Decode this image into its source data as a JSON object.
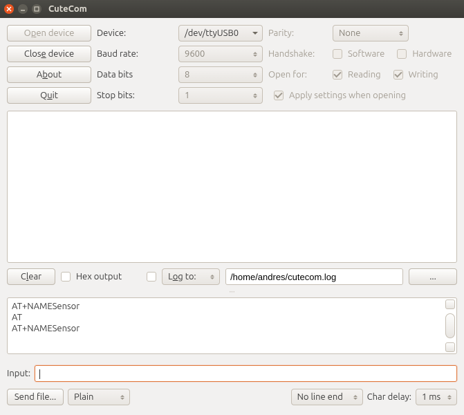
{
  "window": {
    "title": "CuteCom"
  },
  "buttons": {
    "open_pre": "O",
    "open_u": "p",
    "open_post": "en device",
    "close_pre": "Clos",
    "close_u": "e",
    "close_post": " device",
    "about_pre": "A",
    "about_u": "b",
    "about_post": "out",
    "quit_pre": "Q",
    "quit_u": "u",
    "quit_post": "it",
    "clear_pre": "C",
    "clear_u": "l",
    "clear_post": "ear",
    "browse": "...",
    "sendfile": "Send file..."
  },
  "labels": {
    "device": "Device:",
    "baud": "Baud rate:",
    "databits": "Data bits",
    "stopbits": "Stop bits:",
    "parity": "Parity:",
    "handshake": "Handshake:",
    "openfor": "Open for:",
    "software": "Software",
    "hardware": "Hardware",
    "reading": "Reading",
    "writing": "Writing",
    "apply": "Apply settings when opening",
    "hexout": "Hex output",
    "logto_pre": "L",
    "logto_u": "o",
    "logto_post": "g to:",
    "input": "Input:",
    "chardelay": "Char delay:"
  },
  "values": {
    "device": "/dev/ttyUSB0",
    "baud": "9600",
    "databits": "8",
    "stopbits": "1",
    "parity": "None",
    "logfile": "/home/andres/cutecom.log",
    "sendmode": "Plain",
    "lineend": "No line end",
    "chardelay": "1 ms"
  },
  "history": [
    "AT+NAMESensor",
    "AT",
    "AT+NAMESensor"
  ]
}
